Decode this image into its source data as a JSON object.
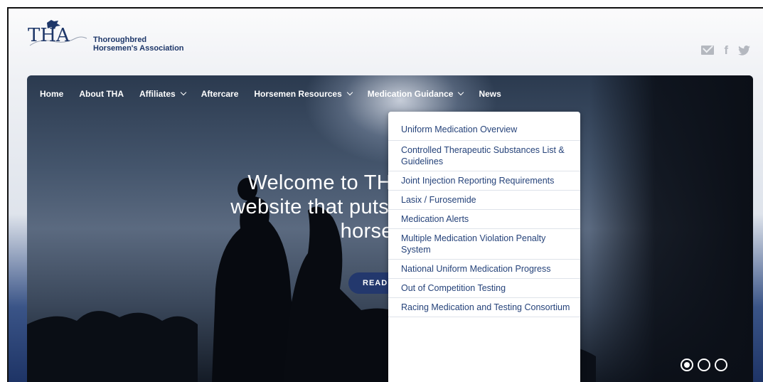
{
  "brand": {
    "logo_text": "THA",
    "name_line1": "Thoroughbred",
    "name_line2": "Horsemen's Association"
  },
  "social": {
    "mail_icon": "mail-icon",
    "facebook_glyph": "f",
    "twitter_icon": "twitter-icon"
  },
  "nav": {
    "items": [
      {
        "label": "Home",
        "dropdown": false
      },
      {
        "label": "About THA",
        "dropdown": false
      },
      {
        "label": "Affiliates",
        "dropdown": true
      },
      {
        "label": "Aftercare",
        "dropdown": false
      },
      {
        "label": "Horsemen Resources",
        "dropdown": true
      },
      {
        "label": "Medication Guidance",
        "dropdown": true
      },
      {
        "label": "News",
        "dropdown": false
      }
    ]
  },
  "hero": {
    "headline_line1": "Welcome to THAracing.com, a",
    "headline_line2": "website that puts the emphasis on",
    "headline_line3": "horsemen.",
    "button_label": "READ MORE"
  },
  "dropdown": {
    "items": [
      "Uniform Medication Overview",
      "Controlled Therapeutic Substances List & Guidelines",
      "Joint Injection Reporting Requirements",
      "Lasix / Furosemide",
      "Medication Alerts",
      "Multiple Medication Violation Penalty System",
      "National Uniform Medication Progress",
      "Out of Competition Testing",
      "Racing Medication and Testing Consortium"
    ]
  },
  "slider": {
    "count": 3,
    "active_index": 0
  },
  "colors": {
    "brand_navy": "#1e3769",
    "link_blue": "#26437a",
    "button": "#23386d"
  }
}
